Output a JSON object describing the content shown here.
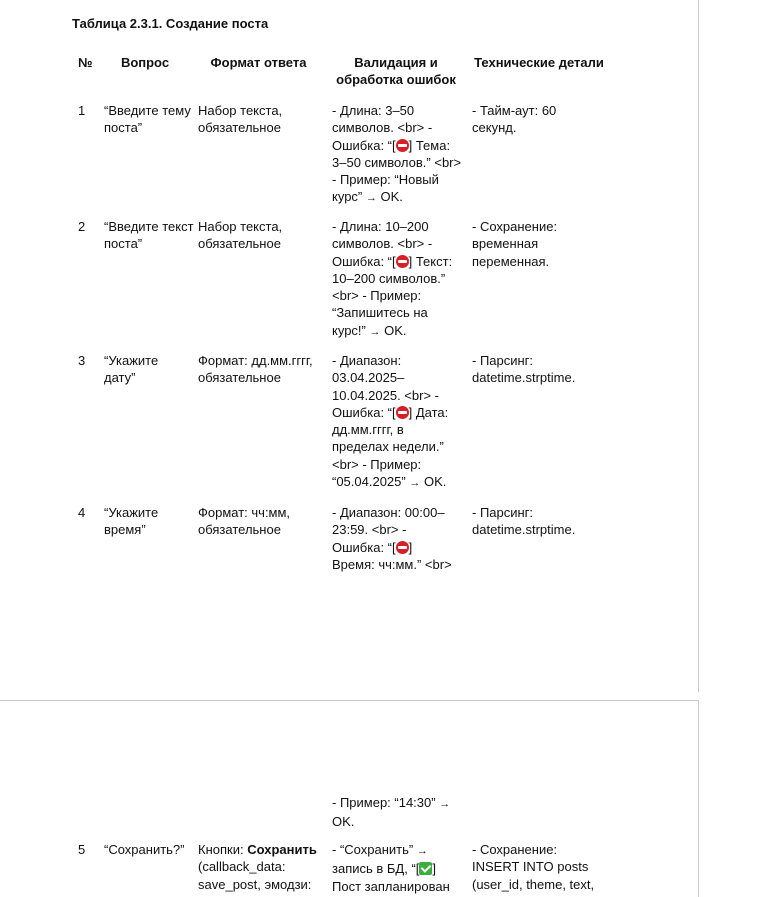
{
  "table_title": "Таблица 2.3.1. Создание поста",
  "headers": {
    "num": "№",
    "question": "Вопрос",
    "format": "Формат ответа",
    "validation_line1": "Валидация и",
    "validation_line2": "обработка ошибок",
    "tech": "Технические детали"
  },
  "rows": [
    {
      "num": "1",
      "question": "“Введите тему поста”",
      "format": "Набор текста, обязательное",
      "validation": {
        "a": "- Длина: 3–50 символов. <br> - Ошибка: “[",
        "icon": "no-entry-icon",
        "b": "] Тема: 3–50 символов.” <br> - Пример: “Новый курс” ",
        "arrow": "→",
        "c": " OK."
      },
      "tech": "- Тайм-аут: 60 секунд."
    },
    {
      "num": "2",
      "question": "“Введите текст поста”",
      "format": "Набор текста, обязательное",
      "validation": {
        "a": "- Длина: 10–200 символов. <br> - Ошибка: “[",
        "icon": "no-entry-icon",
        "b": "] Текст: 10–200 символов.” <br> - Пример: “Запишитесь на курс!” ",
        "arrow": "→",
        "c": " OK."
      },
      "tech": "- Сохранение: временная переменная."
    },
    {
      "num": "3",
      "question": "“Укажите дату”",
      "format": "Формат: дд.мм.гггг, обязательное",
      "validation": {
        "a": "- Диапазон: 03.04.2025–10.04.2025. <br> - Ошибка: “[",
        "icon": "no-entry-icon",
        "b": "] Дата: дд.мм.гггг, в пределах недели.” <br> - Пример: “05.04.2025” ",
        "arrow": "→",
        "c": " OK."
      },
      "tech": "- Парсинг: datetime.strptime."
    },
    {
      "num": "4",
      "question": "“Укажите время”",
      "format": "Формат: чч:мм, обязательное",
      "validation": {
        "a": "- Диапазон: 00:00–23:59. <br> - Ошибка: “[",
        "icon": "no-entry-icon",
        "b": "] Время: чч:мм.” <br>"
      },
      "tech": "- Парсинг: datetime.strptime."
    }
  ],
  "page2": {
    "row4_continuation": {
      "a": "- Пример: “14:30” ",
      "arrow": "→",
      "c": " OK."
    },
    "row5": {
      "num": "5",
      "question": "“Сохранить?”",
      "format_a": "Кнопки: ",
      "format_bold": "Сохранить",
      "format_b": " (callback_data: save_post, эмодзи:",
      "validation_a": "- “Сохранить” ",
      "validation_arrow": "→",
      "validation_b": " запись в БД, “[",
      "validation_icon": "check-mark-icon",
      "validation_c": "] Пост запланирован",
      "tech": "- Сохранение: INSERT INTO posts (user_id, theme, text,"
    }
  }
}
